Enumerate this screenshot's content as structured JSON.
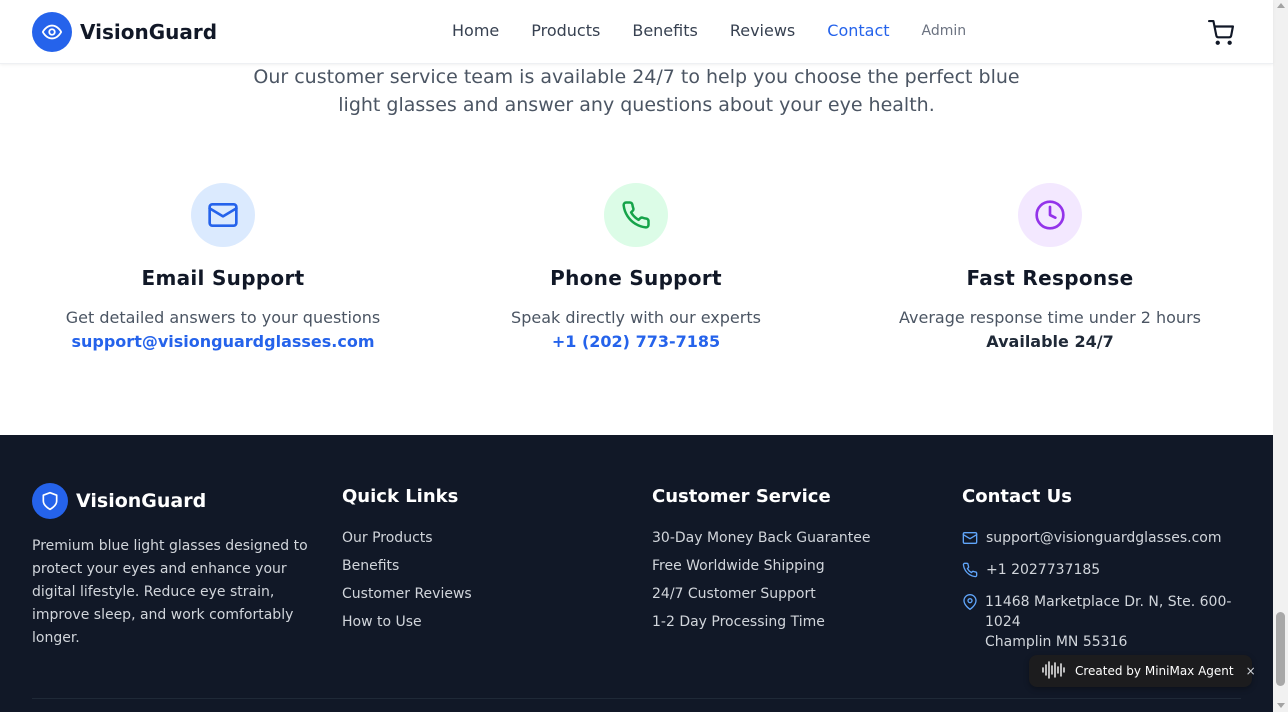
{
  "header": {
    "brand": "VisionGuard",
    "nav": [
      {
        "label": "Home"
      },
      {
        "label": "Products"
      },
      {
        "label": "Benefits"
      },
      {
        "label": "Reviews"
      },
      {
        "label": "Contact",
        "active": true
      }
    ],
    "admin_label": "Admin",
    "cart_icon": "shopping-cart-icon"
  },
  "intro": {
    "text": "Our customer service team is available 24/7 to help you choose the perfect blue light glasses and answer any questions about your eye health."
  },
  "features": [
    {
      "icon": "mail-icon",
      "title": "Email Support",
      "desc": "Get detailed answers to your questions",
      "detail": "support@visionguardglasses.com",
      "circle_color": "#dbeafe",
      "icon_color": "#2563eb"
    },
    {
      "icon": "phone-icon",
      "title": "Phone Support",
      "desc": "Speak directly with our experts",
      "detail": "+1 (202) 773-7185",
      "circle_color": "#dcfce7",
      "icon_color": "#16a34a"
    },
    {
      "icon": "clock-icon",
      "title": "Fast Response",
      "desc": "Average response time under 2 hours",
      "detail": "Available 24/7",
      "circle_color": "#f3e8ff",
      "icon_color": "#9333ea"
    }
  ],
  "footer": {
    "brand": "VisionGuard",
    "about": "Premium blue light glasses designed to protect your eyes and enhance your digital lifestyle. Reduce eye strain, improve sleep, and work comfortably longer.",
    "quick_links": {
      "heading": "Quick Links",
      "items": [
        "Our Products",
        "Benefits",
        "Customer Reviews",
        "How to Use"
      ]
    },
    "customer_service": {
      "heading": "Customer Service",
      "items": [
        "30-Day Money Back Guarantee",
        "Free Worldwide Shipping",
        "24/7 Customer Support",
        "1-2 Day Processing Time"
      ]
    },
    "contact": {
      "heading": "Contact Us",
      "email": "support@visionguardglasses.com",
      "phone": "+1 2027737185",
      "address_line1": "11468 Marketplace Dr. N, Ste. 600-1024",
      "address_line2": "Champlin MN 55316"
    }
  },
  "badge": {
    "text": "Created by MiniMax Agent",
    "close": "×"
  },
  "colors": {
    "accent": "#2563eb",
    "footer_bg": "#111827"
  }
}
